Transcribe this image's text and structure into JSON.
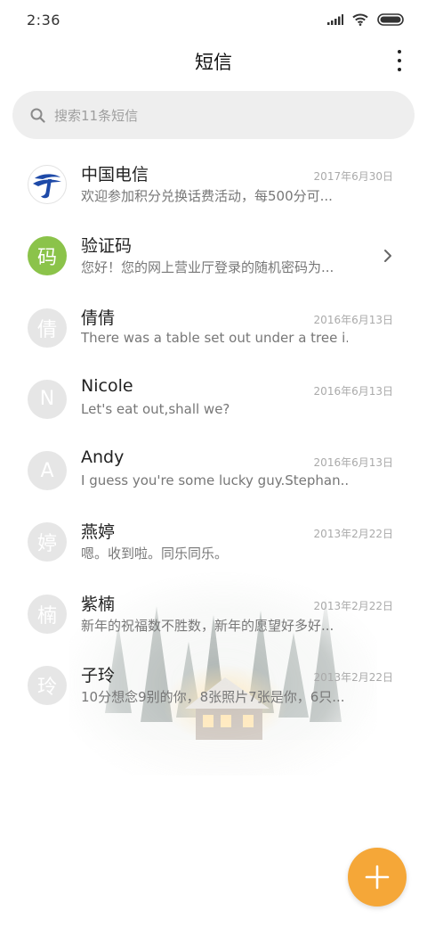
{
  "status_bar": {
    "time": "2:36"
  },
  "header": {
    "title": "短信"
  },
  "search": {
    "placeholder": "搜索11条短信"
  },
  "conversations": [
    {
      "name": "中国电信",
      "date": "2017年6月30日",
      "preview": "欢迎参加积分兑换话费活动，每500分可...",
      "avatar_text": "",
      "avatar_icon": "china-telecom-logo-icon"
    },
    {
      "name": "验证码",
      "date": "",
      "preview": "您好！您的网上营业厅登录的随机密码为...",
      "avatar_text": "码",
      "avatar_color": "#8bc34a"
    },
    {
      "name": "倩倩",
      "date": "2016年6月13日",
      "preview": "There was a table set out under a tree i...",
      "avatar_text": "倩"
    },
    {
      "name": "Nicole",
      "date": "2016年6月13日",
      "preview": "Let's eat out,shall we?",
      "avatar_text": "N"
    },
    {
      "name": "Andy",
      "date": "2016年6月13日",
      "preview": "I guess you're some lucky guy.Stephan...",
      "avatar_text": "A"
    },
    {
      "name": "燕婷",
      "date": "2013年2月22日",
      "preview": "嗯。收到啦。同乐同乐。",
      "avatar_text": "婷"
    },
    {
      "name": "紫楠",
      "date": "2013年2月22日",
      "preview": "新年的祝福数不胜数，新年的愿望好多好...",
      "avatar_text": "楠"
    },
    {
      "name": "子玲",
      "date": "2013年2月22日",
      "preview": "10分想念9别的你，8张照片7张是你，6只...",
      "avatar_text": "玲"
    }
  ],
  "colors": {
    "accent": "#f5a738",
    "verification_avatar": "#8bc34a",
    "default_avatar": "#e6e6e6"
  }
}
